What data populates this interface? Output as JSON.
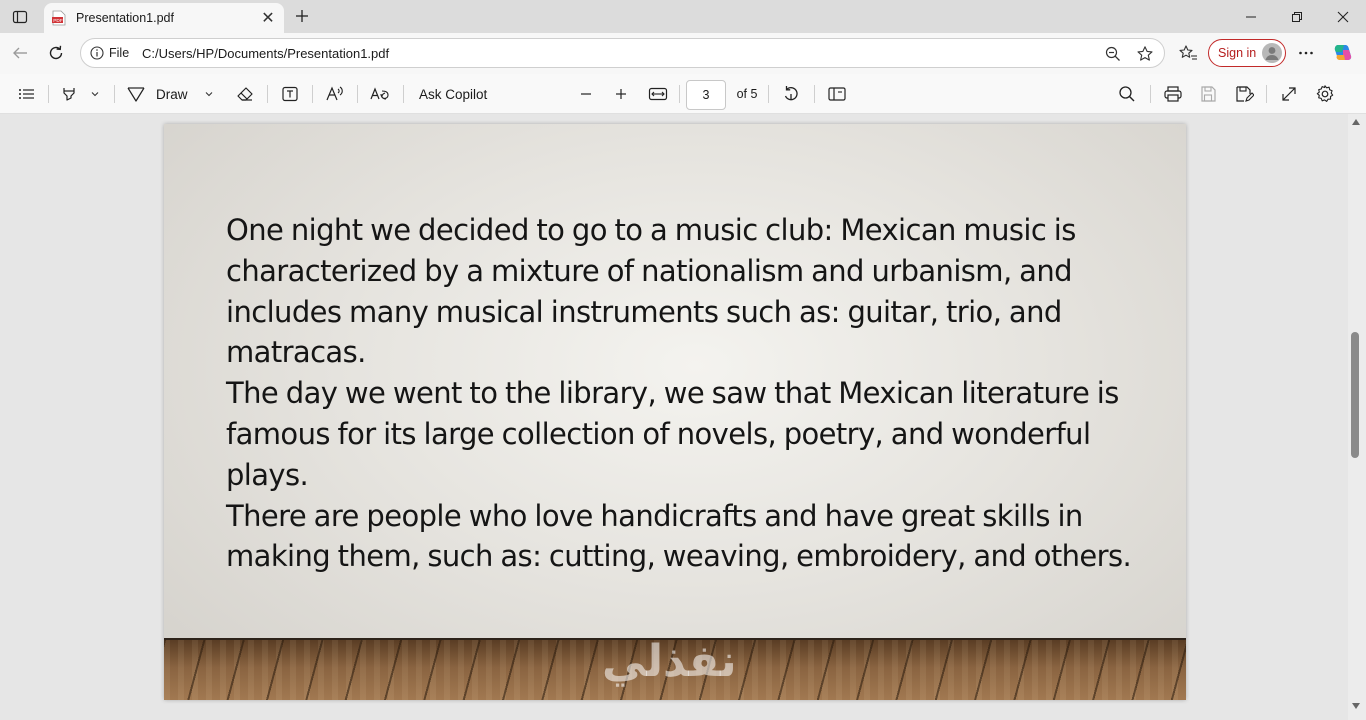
{
  "browser": {
    "tab": {
      "title": "Presentation1.pdf",
      "close_glyph": "✕",
      "pdf_badge": "PDF"
    },
    "newtab_glyph": "+",
    "window_controls": {
      "minimize": "—",
      "restore": "❐",
      "close": "✕"
    }
  },
  "address_bar": {
    "scheme_label": "File",
    "url": "C:/Users/HP/Documents/Presentation1.pdf",
    "signin_label": "Sign in"
  },
  "pdf_toolbar": {
    "draw_label": "Draw",
    "copilot_label": "Ask Copilot",
    "page_current": "3",
    "page_total_label": "of 5"
  },
  "slide": {
    "paragraphs": [
      "One night we decided to go to a music club: Mexican music is characterized by a mixture of nationalism and urbanism, and includes many musical instruments such as: guitar, trio, and matracas.",
      "The day we went to the library, we saw that Mexican literature is famous for its large collection of novels, poetry, and wonderful plays.",
      "There are people who love handicrafts and have great skills in making them, such as: cutting, weaving, embroidery, and others."
    ],
    "watermark_text": "نفذلي"
  },
  "colors": {
    "signin_accent": "#c22a2a",
    "pdf_icon": "#d13438"
  }
}
